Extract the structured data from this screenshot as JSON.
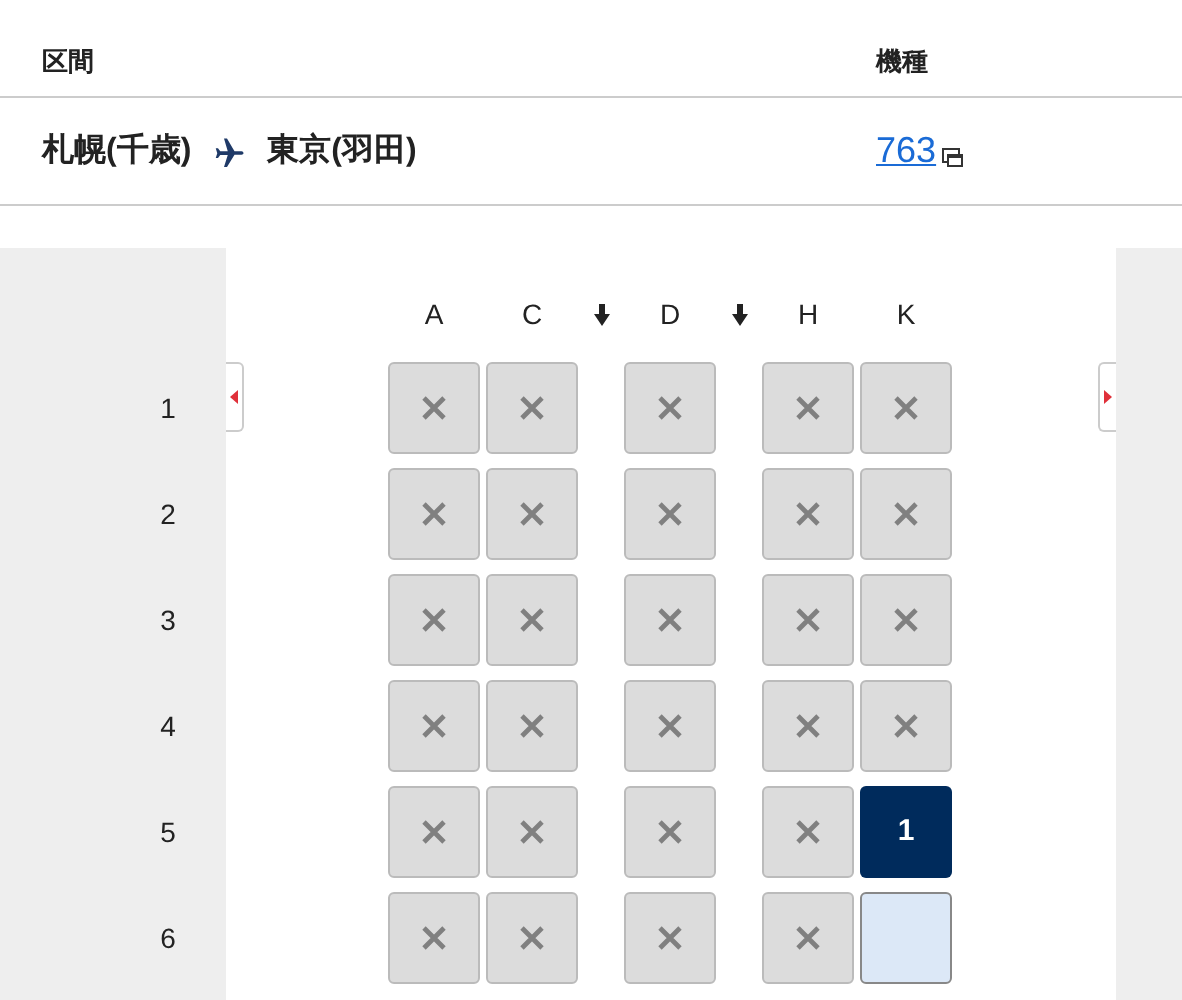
{
  "header": {
    "column_1": "区間",
    "column_2": "機種"
  },
  "route": {
    "from": "札幌(千歳)",
    "to": "東京(羽田)",
    "aircraft": "763"
  },
  "columns": [
    {
      "kind": "seat",
      "label": "A"
    },
    {
      "kind": "seat",
      "label": "C"
    },
    {
      "kind": "aisle"
    },
    {
      "kind": "seat",
      "label": "D"
    },
    {
      "kind": "aisle"
    },
    {
      "kind": "seat",
      "label": "H"
    },
    {
      "kind": "seat",
      "label": "K"
    }
  ],
  "rows": [
    {
      "number": "1",
      "seats": [
        {
          "kind": "occupied"
        },
        {
          "kind": "occupied"
        },
        {
          "kind": "occupied"
        },
        {
          "kind": "occupied"
        },
        {
          "kind": "occupied"
        }
      ]
    },
    {
      "number": "2",
      "seats": [
        {
          "kind": "occupied"
        },
        {
          "kind": "occupied"
        },
        {
          "kind": "occupied"
        },
        {
          "kind": "occupied"
        },
        {
          "kind": "occupied"
        }
      ]
    },
    {
      "number": "3",
      "seats": [
        {
          "kind": "occupied"
        },
        {
          "kind": "occupied"
        },
        {
          "kind": "occupied"
        },
        {
          "kind": "occupied"
        },
        {
          "kind": "occupied"
        }
      ]
    },
    {
      "number": "4",
      "seats": [
        {
          "kind": "occupied"
        },
        {
          "kind": "occupied"
        },
        {
          "kind": "occupied"
        },
        {
          "kind": "occupied"
        },
        {
          "kind": "occupied"
        }
      ]
    },
    {
      "number": "5",
      "seats": [
        {
          "kind": "occupied"
        },
        {
          "kind": "occupied"
        },
        {
          "kind": "occupied"
        },
        {
          "kind": "occupied"
        },
        {
          "kind": "selected",
          "label": "1"
        }
      ]
    },
    {
      "number": "6",
      "seats": [
        {
          "kind": "occupied"
        },
        {
          "kind": "occupied"
        },
        {
          "kind": "occupied"
        },
        {
          "kind": "occupied"
        },
        {
          "kind": "available"
        }
      ]
    }
  ]
}
